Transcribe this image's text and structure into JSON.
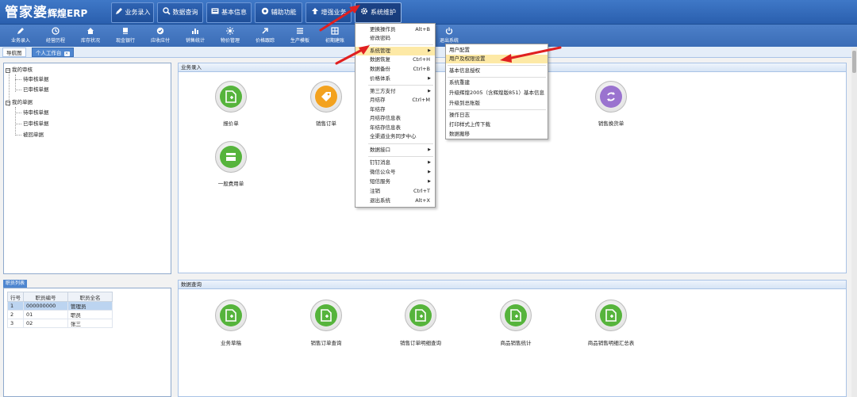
{
  "app": {
    "brand": "管家婆",
    "brand_sub": "辉煌ERP"
  },
  "colors": {
    "accent": "#2a5fae",
    "arrow": "#e02020",
    "highlight": "#fde9a6",
    "icon_green": "#56b43c",
    "icon_orange": "#f3a21f",
    "icon_purple": "#9a73cf"
  },
  "mainmenu": [
    {
      "label": "业务录入",
      "icon": "pencil-icon"
    },
    {
      "label": "数据查询",
      "icon": "search-icon"
    },
    {
      "label": "基本信息",
      "icon": "info-card-icon"
    },
    {
      "label": "辅助功能",
      "icon": "gear-circle-icon"
    },
    {
      "label": "增强业务",
      "icon": "arrow-up-icon"
    },
    {
      "label": "系统维护",
      "icon": "gear-icon"
    }
  ],
  "toolbar": [
    "业务录入",
    "经营历程",
    "库存状况",
    "现金银行",
    "应收应付",
    "销售统计",
    "物价管理",
    "价格跟踪",
    "生产模板",
    "初期建账",
    "",
    "退出系统"
  ],
  "tabs": {
    "nav": "导航图",
    "workbench": "个人工作台"
  },
  "tree": {
    "group1": "我的审核",
    "g1_items": [
      "待审核单据",
      "已审核单据"
    ],
    "group2": "我的单据",
    "g2_items": [
      "待审核单据",
      "已审核单据",
      "被回单据"
    ]
  },
  "employees": {
    "title": "职员列表",
    "headers": [
      "行号",
      "职员编号",
      "职员全名"
    ],
    "rows": [
      [
        "1",
        "000000000",
        "管理员"
      ],
      [
        "2",
        "01",
        "职员"
      ],
      [
        "3",
        "02",
        "张三"
      ]
    ]
  },
  "panels": {
    "entry": {
      "title": "业务录入",
      "items": [
        "报价单",
        "销售订单",
        "销售换货单",
        "一般费用单"
      ]
    },
    "query": {
      "title": "数据查询",
      "items": [
        "业务草稿",
        "销售订单查询",
        "销售订单明细查询",
        "商品销售统计",
        "商品销售明细汇总表"
      ]
    }
  },
  "dropdown": [
    {
      "label": "更换操作员",
      "shortcut": "Alt+B"
    },
    {
      "label": "修改密码",
      "shortcut": ""
    },
    {
      "label": "系统管理",
      "shortcut": "",
      "arrow": true,
      "highlight": true
    },
    {
      "label": "数据恢复",
      "shortcut": "Ctrl+H"
    },
    {
      "label": "数据备份",
      "shortcut": "Ctrl+B"
    },
    {
      "label": "价格体系",
      "shortcut": "",
      "arrow": true
    },
    {
      "label": "第三方支付",
      "shortcut": "",
      "arrow": true
    },
    {
      "label": "月结存",
      "shortcut": "Ctrl+M"
    },
    {
      "label": "年结存",
      "shortcut": ""
    },
    {
      "label": "月结存信息表",
      "shortcut": ""
    },
    {
      "label": "年结存信息表",
      "shortcut": ""
    },
    {
      "label": "全渠道业务同步中心",
      "shortcut": ""
    },
    {
      "label": "数据接口",
      "shortcut": "",
      "arrow": true
    },
    {
      "label": "钉钉消息",
      "shortcut": "",
      "arrow": true
    },
    {
      "label": "微信公众号",
      "shortcut": "",
      "arrow": true
    },
    {
      "label": "短信服务",
      "shortcut": "",
      "arrow": true
    },
    {
      "label": "注销",
      "shortcut": "Ctrl+T"
    },
    {
      "label": "退出系统",
      "shortcut": "Alt+X"
    }
  ],
  "submenu": [
    {
      "label": "用户配置"
    },
    {
      "label": "用户及权限设置",
      "highlight": true
    },
    {
      "label": "基本信息授权"
    },
    {
      "label": "系统重建"
    },
    {
      "label": "升级辉煌2005（含辉煌版851）基本信息"
    },
    {
      "label": "升级到总账版"
    },
    {
      "label": "操作日志"
    },
    {
      "label": "打印样式上传下载"
    },
    {
      "label": "数据搬移"
    }
  ]
}
